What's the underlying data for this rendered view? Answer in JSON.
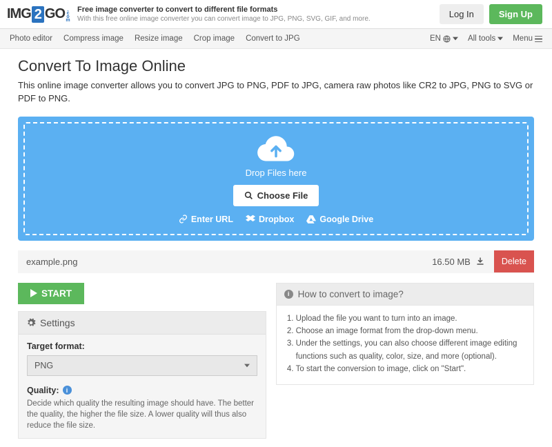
{
  "header": {
    "logo_pre": "IMG",
    "logo_num": "2",
    "logo_post": "GO",
    "logo_com": ".com",
    "tagline1": "Free image converter to convert to different file formats",
    "tagline2": "With this free online image converter you can convert image to JPG, PNG, SVG, GIF, and more.",
    "login": "Log In",
    "signup": "Sign Up"
  },
  "nav": {
    "items": [
      "Photo editor",
      "Compress image",
      "Resize image",
      "Crop image",
      "Convert to JPG"
    ],
    "lang": "EN",
    "alltools": "All tools",
    "menu": "Menu"
  },
  "page": {
    "title": "Convert To Image Online",
    "subtitle": "This online image converter allows you to convert JPG to PNG, PDF to JPG, camera raw photos like CR2 to JPG, PNG to SVG or PDF to PNG."
  },
  "dropzone": {
    "drop_text": "Drop Files here",
    "choose": "Choose File",
    "url": "Enter URL",
    "dropbox": "Dropbox",
    "gdrive": "Google Drive"
  },
  "file": {
    "name": "example.png",
    "size": "16.50 MB",
    "delete": "Delete"
  },
  "start": "START",
  "settings": {
    "title": "Settings",
    "target_format_label": "Target format:",
    "target_format_value": "PNG",
    "quality_label": "Quality:",
    "quality_desc": "Decide which quality the resulting image should have. The better the quality, the higher the file size. A lower quality will thus also reduce the file size."
  },
  "howto": {
    "title": "How to convert to image?",
    "steps": [
      "Upload the file you want to turn into an image.",
      "Choose an image format from the drop-down menu.",
      "Under the settings, you can also choose different image editing functions such as quality, color, size, and more (optional).",
      "To start the conversion to image, click on \"Start\"."
    ]
  }
}
